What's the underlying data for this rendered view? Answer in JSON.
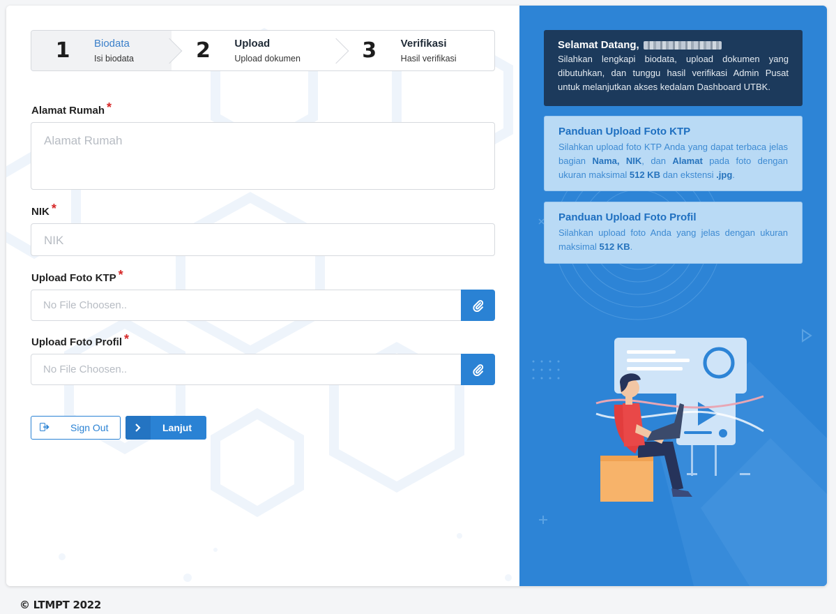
{
  "stepper": {
    "steps": [
      {
        "num": "1",
        "title": "Biodata",
        "sub": "Isi biodata"
      },
      {
        "num": "2",
        "title": "Upload",
        "sub": "Upload dokumen"
      },
      {
        "num": "3",
        "title": "Verifikasi",
        "sub": "Hasil verifikasi"
      }
    ]
  },
  "form": {
    "alamat": {
      "label": "Alamat Rumah",
      "required": "*",
      "placeholder": "Alamat Rumah"
    },
    "nik": {
      "label": "NIK",
      "required": "*",
      "placeholder": "NIK"
    },
    "ktp": {
      "label": "Upload Foto KTP",
      "required": "*",
      "placeholder": "No File Choosen.."
    },
    "profil": {
      "label": "Upload Foto Profil",
      "required": "*",
      "placeholder": "No File Choosen.."
    }
  },
  "actions": {
    "signout": "Sign Out",
    "next": "Lanjut"
  },
  "panels": {
    "welcome": {
      "title": "Selamat Datang,",
      "body": "Silahkan lengkapi biodata, upload dokumen yang dibutuhkan, dan tunggu hasil verifikasi Admin Pusat untuk melanjutkan akses kedalam Dashboard UTBK."
    },
    "ktp": {
      "title": "Panduan Upload Foto KTP",
      "t1": "Silahkan upload foto KTP Anda yang dapat terbaca jelas bagian ",
      "b1": "Nama",
      "t2": ", ",
      "b2": "NIK",
      "t3": ", dan ",
      "b3": "Alamat",
      "t4": " pada foto dengan ukuran maksimal ",
      "b4": "512 KB",
      "t5": " dan ekstensi ",
      "b5": ".jpg",
      "t6": "."
    },
    "profil": {
      "title": "Panduan Upload Foto Profil",
      "t1": "Silahkan upload foto Anda yang jelas dengan ukuran maksimal ",
      "b1": "512 KB",
      "t2": "."
    }
  },
  "footer": "© LTMPT 2022",
  "colors": {
    "primary": "#2a82d4",
    "panel_dark": "#1c3a5c",
    "panel_light": "#b9daf5",
    "right_bg": "#2d84d6",
    "required": "#d62828"
  }
}
